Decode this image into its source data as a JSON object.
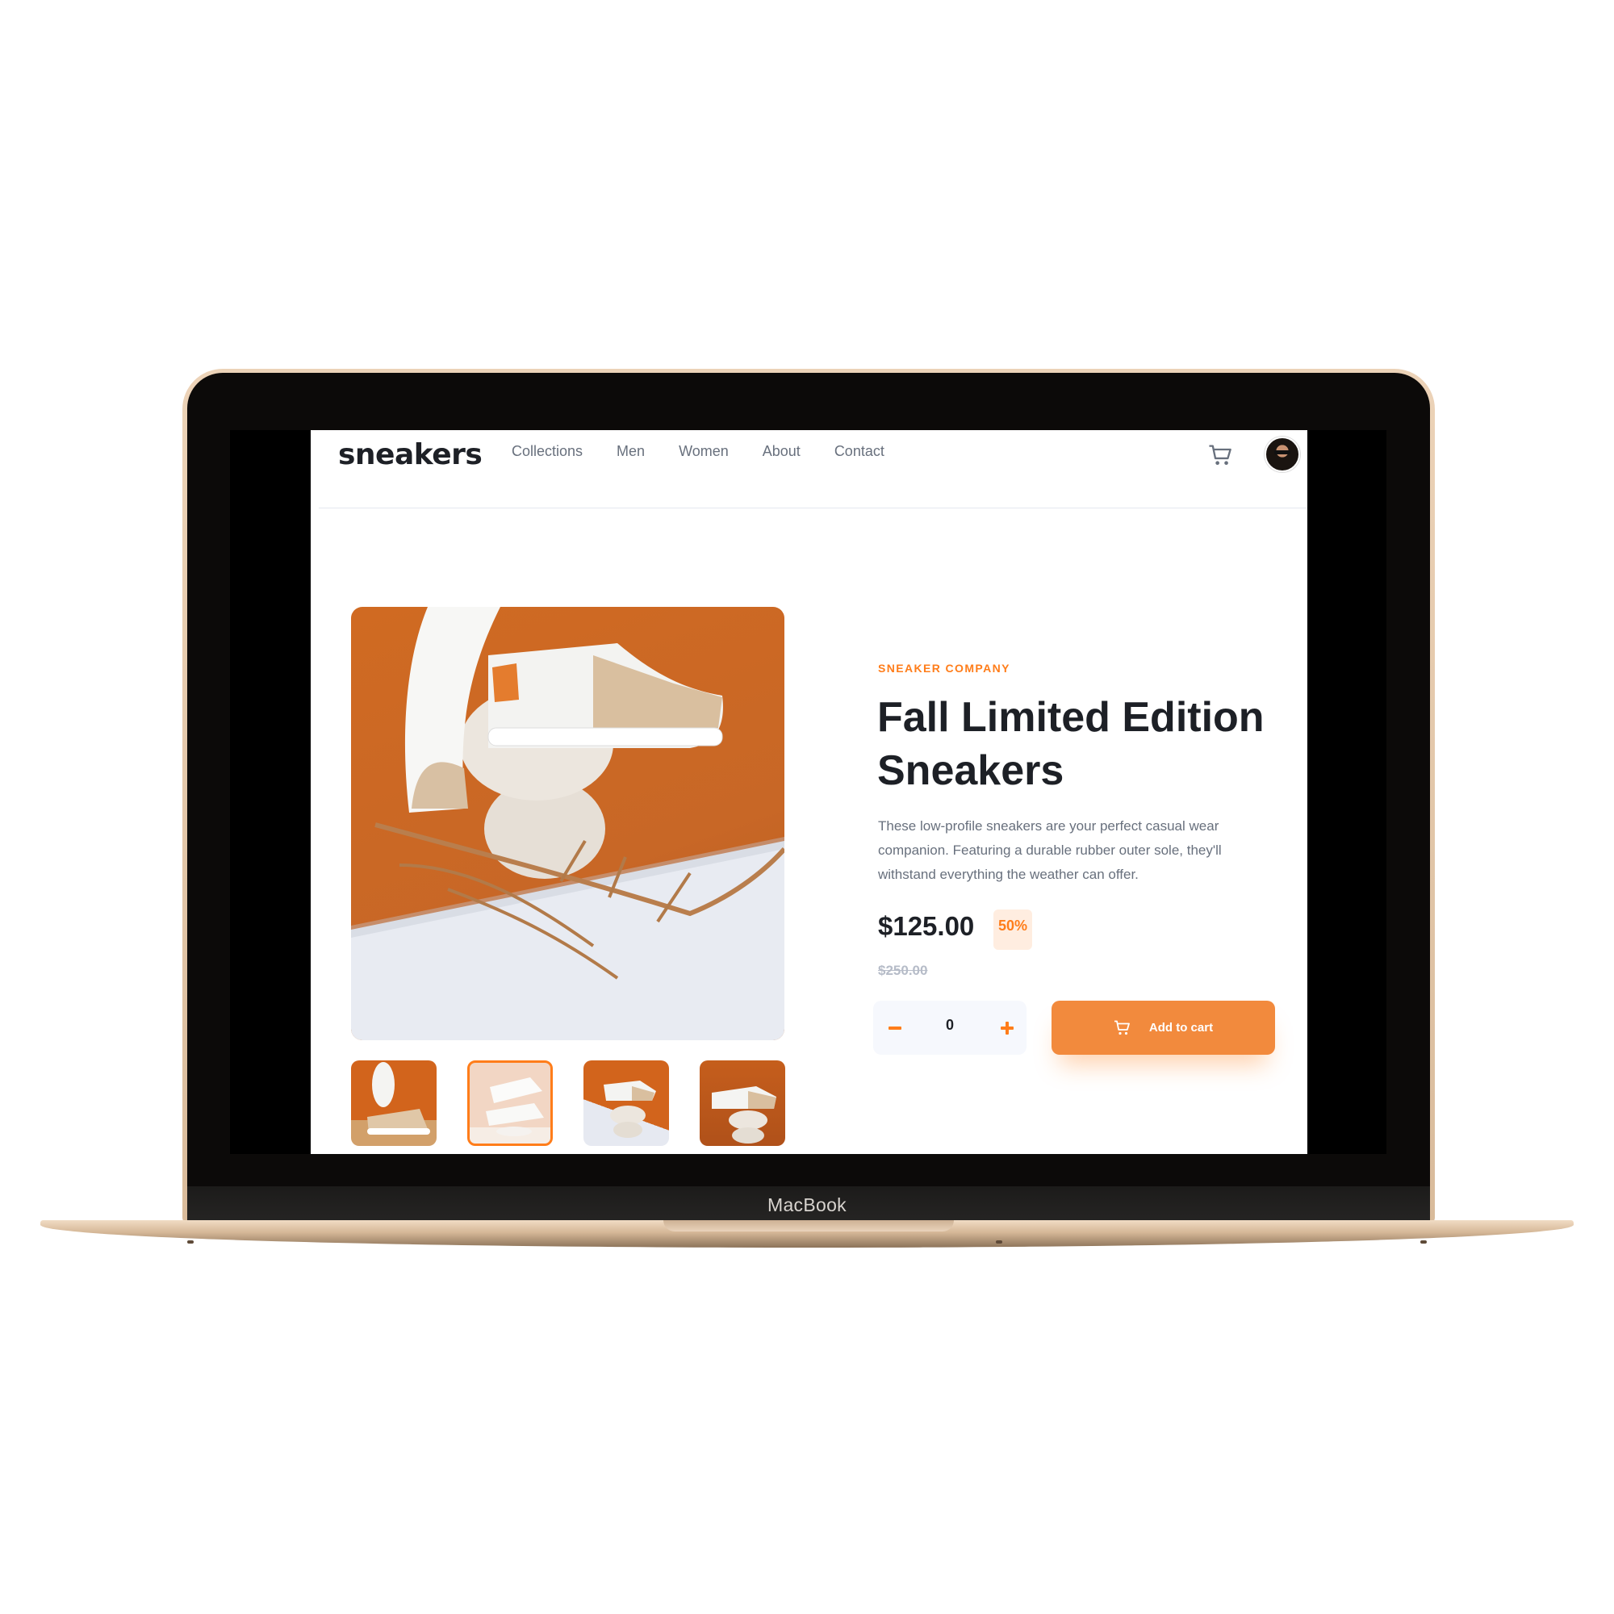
{
  "device": {
    "label": "MacBook"
  },
  "store": {
    "logo": "sneakers",
    "nav": [
      "Collections",
      "Men",
      "Women",
      "About",
      "Contact"
    ]
  },
  "product": {
    "company": "SNEAKER COMPANY",
    "title": "Fall Limited Edition Sneakers",
    "description": "These low-profile sneakers are your perfect casual wear companion. Featuring a durable rubber outer sole, they'll withstand everything the weather can offer.",
    "price": "$125.00",
    "discount": "50%",
    "original_price": "$250.00",
    "quantity": "0",
    "add_to_cart": "Add to cart"
  },
  "colors": {
    "accent": "#ff7d1a",
    "button": "#f28a3d",
    "heading": "#1d2026",
    "body": "#68707d",
    "muted": "#b6bcc8"
  },
  "icons": [
    "cart-icon",
    "avatar",
    "minus-icon",
    "plus-icon"
  ]
}
